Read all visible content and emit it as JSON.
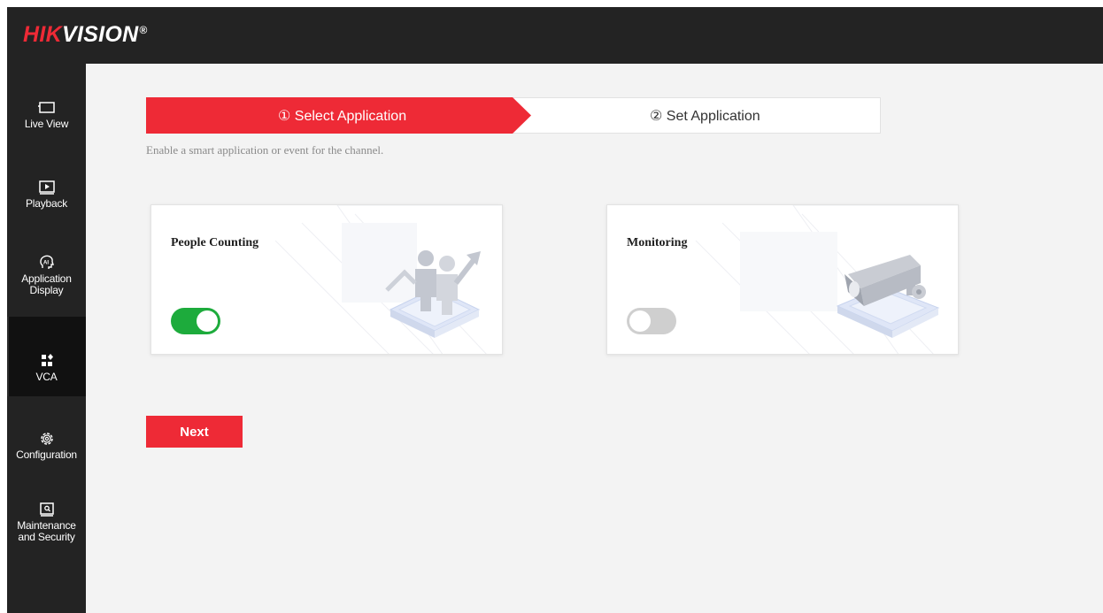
{
  "brand": {
    "part1": "HIK",
    "part2": "VISION",
    "mark": "®"
  },
  "colors": {
    "brand_red": "#ee2a36",
    "toggle_on": "#1dab3c",
    "toggle_off": "#cfcfcf",
    "sidebar": "#232323"
  },
  "sidebar": {
    "items": [
      {
        "label": "Live View",
        "icon": "monitor-icon"
      },
      {
        "label": "Playback",
        "icon": "play-screen-icon"
      },
      {
        "label": "Application Display",
        "icon": "ai-brain-icon"
      },
      {
        "label": "VCA",
        "icon": "grid-diamond-icon",
        "active": true
      },
      {
        "label": "Configuration",
        "icon": "gear-icon"
      },
      {
        "label": "Maintenance and Security",
        "icon": "shield-screen-icon"
      }
    ]
  },
  "wizard": {
    "steps": [
      {
        "label": "① Select Application",
        "active": true
      },
      {
        "label": "② Set Application",
        "active": false
      }
    ],
    "subtitle": "Enable a smart application or event for the channel."
  },
  "apps": [
    {
      "title": "People Counting",
      "enabled": true,
      "icon": "people-counting-illustration"
    },
    {
      "title": "Monitoring",
      "enabled": false,
      "icon": "bullet-camera-illustration"
    }
  ],
  "actions": {
    "next_label": "Next"
  }
}
